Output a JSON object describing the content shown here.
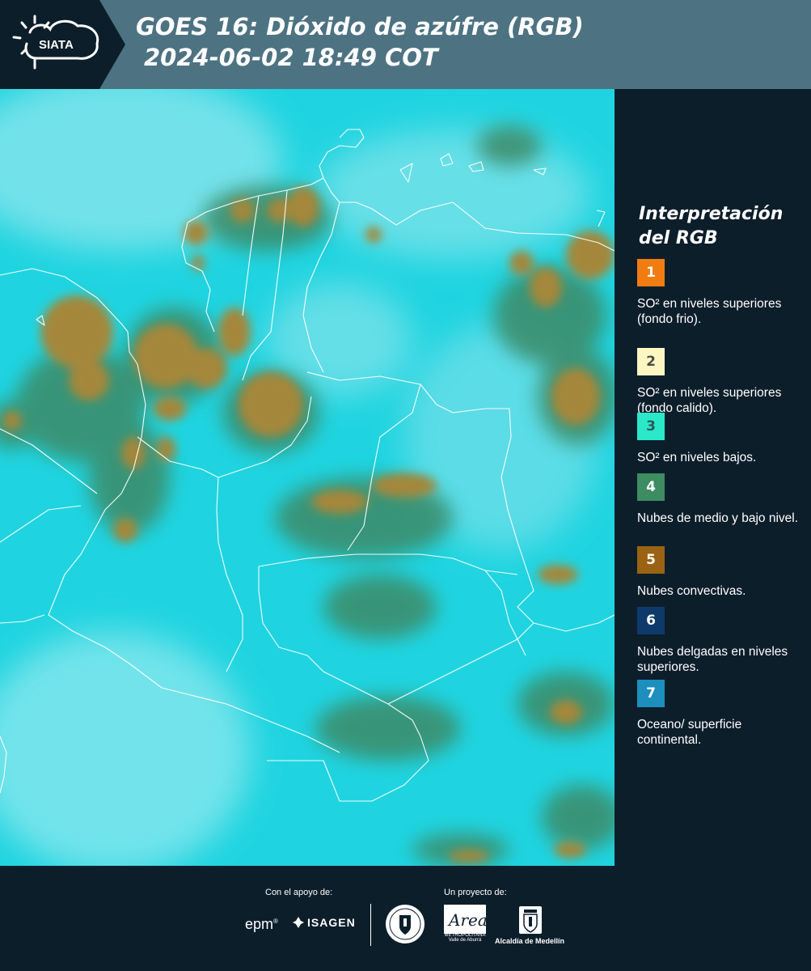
{
  "header": {
    "logo_text": "SIATA",
    "title_line1": "GOES 16: Dióxido de azúfre (RGB)",
    "title_line2": "2024-06-02 18:49 COT"
  },
  "legend": {
    "title_line1": "Interpretación",
    "title_line2": "del RGB",
    "items": [
      {
        "number": "1",
        "label": "SO² en niveles superiores (fondo frio).",
        "color": "#f07c12",
        "text_color": "#ffffff"
      },
      {
        "number": "2",
        "label": "SO² en niveles superiores (fondo calido).",
        "color": "#fdf6c2",
        "text_color": "#4a4a4a"
      },
      {
        "number": "3",
        "label": "SO² en niveles bajos.",
        "color": "#2ae8c8",
        "text_color": "#2a5a5a"
      },
      {
        "number": "4",
        "label": "Nubes de medio y bajo nivel.",
        "color": "#3d8c62",
        "text_color": "#ffffff"
      },
      {
        "number": "5",
        "label": "Nubes convectivas.",
        "color": "#9a6212",
        "text_color": "#ffffff"
      },
      {
        "number": "6",
        "label": "Nubes delgadas en niveles superiores.",
        "color": "#0d3a6a",
        "text_color": "#ffffff"
      },
      {
        "number": "7",
        "label": "Oceano/ superficie continental.",
        "color": "#1c8fbf",
        "text_color": "#ffffff"
      }
    ]
  },
  "footer": {
    "support_caption": "Con el apoyo de:",
    "project_caption": "Un proyecto de:",
    "sponsor_epm": "epm",
    "sponsor_isagen": "ISAGEN",
    "sponsor_amva": "Area",
    "sponsor_amva_sub": "METROPOLITANA Valle de Aburrá",
    "sponsor_medellin": "Alcaldía de Medellín"
  },
  "colors": {
    "header_bg": "#4d7382",
    "logo_panel_bg": "#0d1e2b",
    "page_bg": "#0d1e2b",
    "map_base": "#19d6e0",
    "map_light": "#8ee8ee",
    "cloud_convective": "#a7873a",
    "cloud_low": "#3e8a66",
    "border_lines": "#ffffff"
  }
}
